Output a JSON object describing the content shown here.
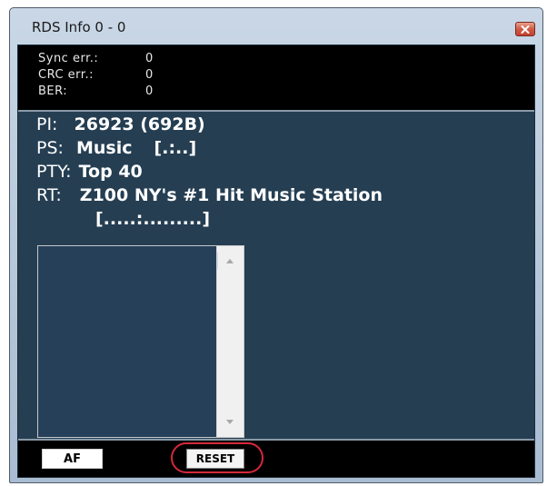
{
  "window": {
    "title": "RDS Info 0 - 0"
  },
  "stats": {
    "sync_label": "Sync err.:",
    "sync_value": "0",
    "crc_label": "CRC err.:",
    "crc_value": "0",
    "ber_label": "BER:",
    "ber_value": "0"
  },
  "rds": {
    "pi_label": "PI:",
    "pi_value": "26923 (692B)",
    "ps_label": "PS:",
    "ps_value": "Music",
    "ps_flags": "[.:..]",
    "pty_label": "PTY:",
    "pty_value": "Top 40",
    "rt_label": "RT:",
    "rt_value": "Z100 NY's #1 Hit Music Station",
    "rt_flags": "[.....:.........]"
  },
  "buttons": {
    "af_label": "AF",
    "reset_label": "RESET"
  },
  "colors": {
    "panel_background": "#253e52",
    "highlight_ring": "#d6283a"
  },
  "icons": {
    "close": "close-icon",
    "scroll_up": "scroll-up-arrow-icon",
    "scroll_down": "scroll-down-arrow-icon"
  }
}
